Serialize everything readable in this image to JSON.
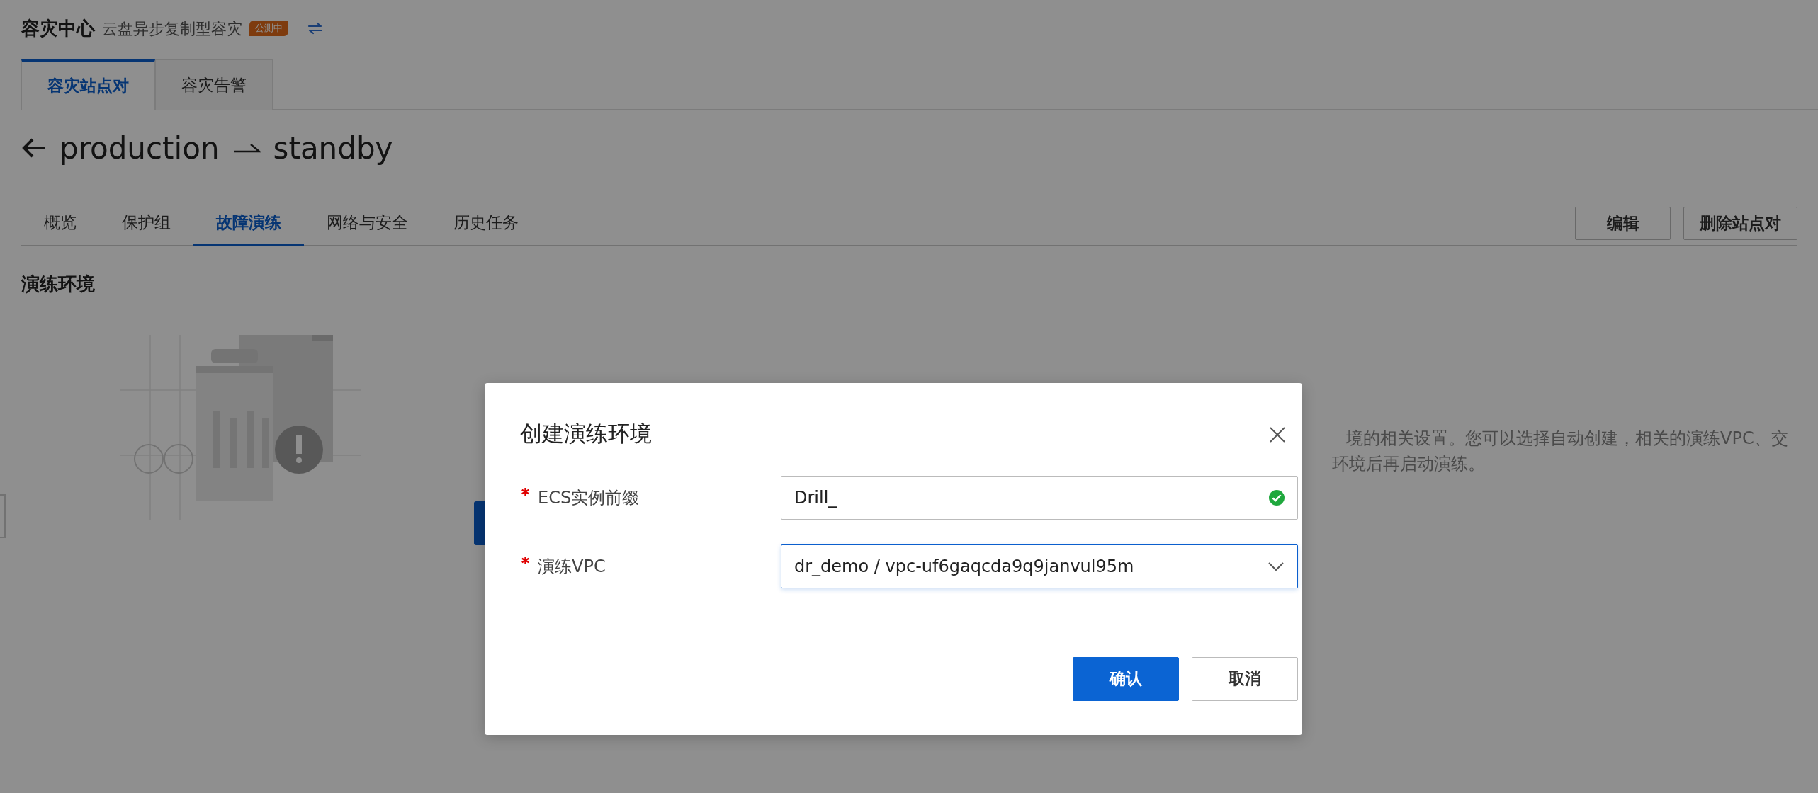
{
  "header": {
    "title": "容灾中心",
    "subtitle": "云盘异步复制型容灾",
    "badge": "公测中"
  },
  "top_tabs": [
    {
      "label": "容灾站点对",
      "selected": true
    },
    {
      "label": "容灾告警",
      "selected": false
    }
  ],
  "page_title": {
    "source": "production",
    "target": "standby"
  },
  "sub_tabs": [
    {
      "label": "概览",
      "selected": false
    },
    {
      "label": "保护组",
      "selected": false
    },
    {
      "label": "故障演练",
      "selected": true
    },
    {
      "label": "网络与安全",
      "selected": false
    },
    {
      "label": "历史任务",
      "selected": false
    }
  ],
  "actions": [
    "编辑",
    "删除站点对"
  ],
  "section_title": "演练环境",
  "background_text": [
    "境的相关设置。您可以选择自动创建，相关的演练VPC、交",
    "环境后再启动演练。"
  ],
  "dialog": {
    "title": "创建演练环境",
    "fields": [
      {
        "kind": "input",
        "label": "ECS实例前缀",
        "required": true,
        "value": "Drill_",
        "valid": true,
        "focused": false
      },
      {
        "kind": "select",
        "label": "演练VPC",
        "required": true,
        "value": "dr_demo / vpc-uf6gaqcda9q9janvul95m",
        "focused": true
      }
    ],
    "buttons": [
      {
        "label": "确认",
        "primary": true
      },
      {
        "label": "取消",
        "primary": false
      }
    ]
  }
}
